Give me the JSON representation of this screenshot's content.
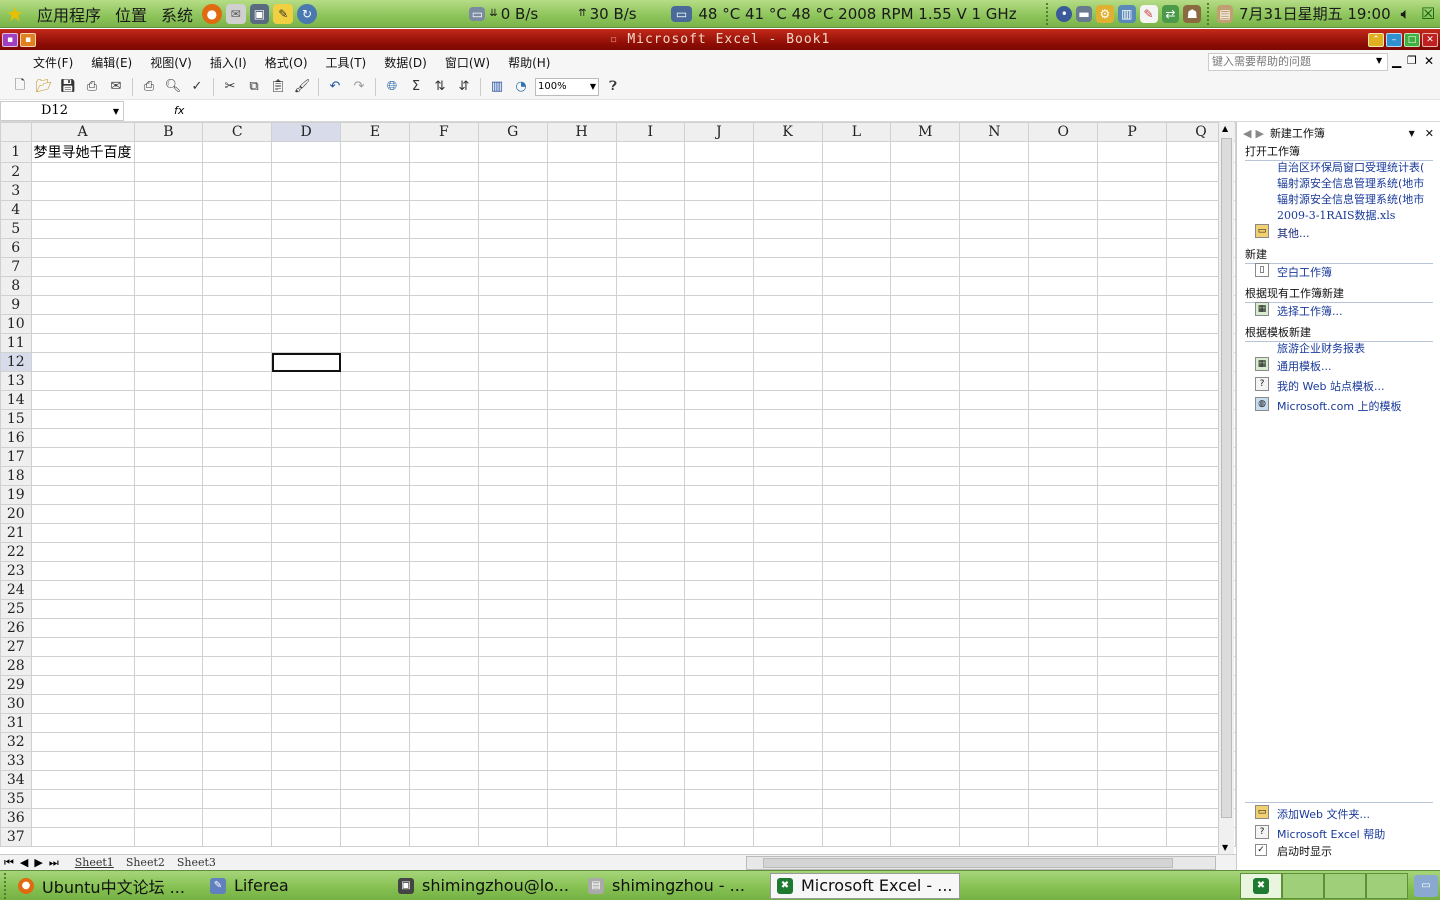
{
  "top_panel": {
    "menus": [
      "应用程序",
      "位置",
      "系统"
    ],
    "net_down": "0 B/s",
    "net_up": "30 B/s",
    "sensors": "48 °C 41 °C 48 °C 2008 RPM 1.55 V 1 GHz",
    "clock": "7月31日星期五 19:00"
  },
  "window": {
    "title": "Microsoft Excel - Book1"
  },
  "menubar": {
    "items": [
      "文件(F)",
      "编辑(E)",
      "视图(V)",
      "插入(I)",
      "格式(O)",
      "工具(T)",
      "数据(D)",
      "窗口(W)",
      "帮助(H)"
    ],
    "help_placeholder": "键入需要帮助的问题"
  },
  "toolbar": {
    "zoom": "100%"
  },
  "formula_bar": {
    "name_box": "D12",
    "fx_label": "fx",
    "formula": ""
  },
  "sheet": {
    "columns": [
      "A",
      "B",
      "C",
      "D",
      "E",
      "F",
      "G",
      "H",
      "I",
      "J",
      "K",
      "L",
      "M",
      "N",
      "O",
      "P",
      "Q"
    ],
    "visible_rows": 37,
    "selected_cell": "D12",
    "cells": {
      "A1": "梦里寻她千百度"
    },
    "tabs": [
      "Sheet1",
      "Sheet2",
      "Sheet3"
    ],
    "active_tab": "Sheet1"
  },
  "task_pane": {
    "title": "新建工作簿",
    "sections": {
      "open": "打开工作簿",
      "new": "新建",
      "from_existing": "根据现有工作簿新建",
      "from_template": "根据模板新建"
    },
    "recent_files": [
      "自治区环保局窗口受理统计表(",
      "辐射源安全信息管理系统(地市",
      "辐射源安全信息管理系统(地市",
      "2009-3-1RAIS数据.xls"
    ],
    "more": "其他...",
    "blank_workbook": "空白工作簿",
    "choose_workbook": "选择工作簿...",
    "templates": [
      "旅游企业财务报表",
      "通用模板...",
      "我的 Web 站点模板...",
      "Microsoft.com 上的模板"
    ],
    "add_web_folder": "添加Web 文件夹...",
    "excel_help": "Microsoft Excel 帮助",
    "show_at_startup": "启动时显示"
  },
  "taskbar": {
    "tasks": [
      "Ubuntu中文论坛 ...",
      "Liferea",
      "shimingzhou@lo...",
      "shimingzhou - ...",
      "Microsoft Excel - ..."
    ]
  }
}
